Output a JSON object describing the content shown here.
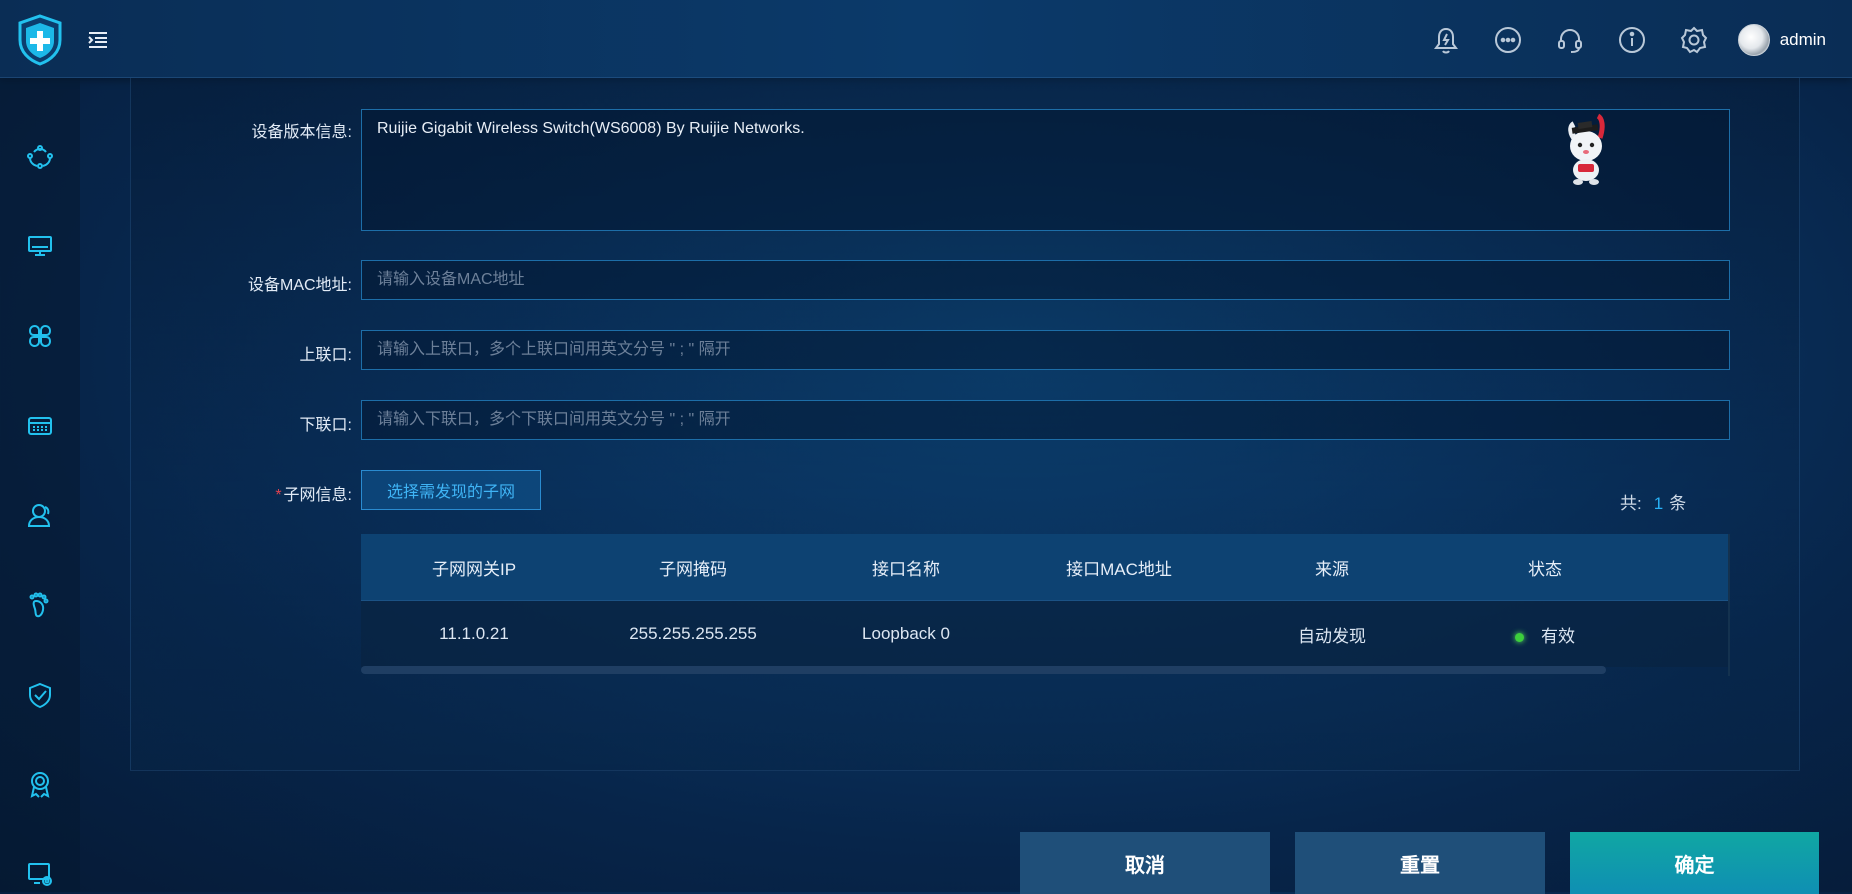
{
  "header": {
    "user_name": "admin",
    "icons": [
      "bell-icon",
      "more-icon",
      "headset-icon",
      "info-icon",
      "settings-icon"
    ]
  },
  "sidebar": {
    "items": [
      "network-topology-icon",
      "monitor-icon",
      "apps-icon",
      "device-icon",
      "user-icon",
      "footprint-icon",
      "shield-check-icon",
      "badge-icon",
      "screen-settings-icon"
    ]
  },
  "form": {
    "version_label": "设备版本信息:",
    "version_value": "Ruijie Gigabit Wireless Switch(WS6008) By Ruijie Networks.",
    "mac_label": "设备MAC地址:",
    "mac_placeholder": "请输入设备MAC地址",
    "uplink_label": "上联口:",
    "uplink_placeholder": "请输入上联口，多个上联口间用英文分号 \" ; \" 隔开",
    "downlink_label": "下联口:",
    "downlink_placeholder": "请输入下联口，多个下联口间用英文分号 \" ; \" 隔开",
    "subnet_required_mark": "*",
    "subnet_label": "子网信息:",
    "subnet_button": "选择需发现的子网"
  },
  "count": {
    "prefix": "共:",
    "value": "1",
    "suffix": "条"
  },
  "table": {
    "headers": [
      "子网网关IP",
      "子网掩码",
      "接口名称",
      "接口MAC地址",
      "来源",
      "状态"
    ],
    "rows": [
      {
        "gateway_ip": "11.1.0.21",
        "mask": "255.255.255.255",
        "interface": "Loopback 0",
        "mac": "",
        "source": "自动发现",
        "status": "有效",
        "status_color": "#3ccf3c"
      }
    ]
  },
  "footer": {
    "cancel": "取消",
    "reset": "重置",
    "confirm": "确定"
  },
  "colors": {
    "accent": "#28b1f6",
    "confirm": "#10a7a3",
    "required": "#e0424f"
  }
}
